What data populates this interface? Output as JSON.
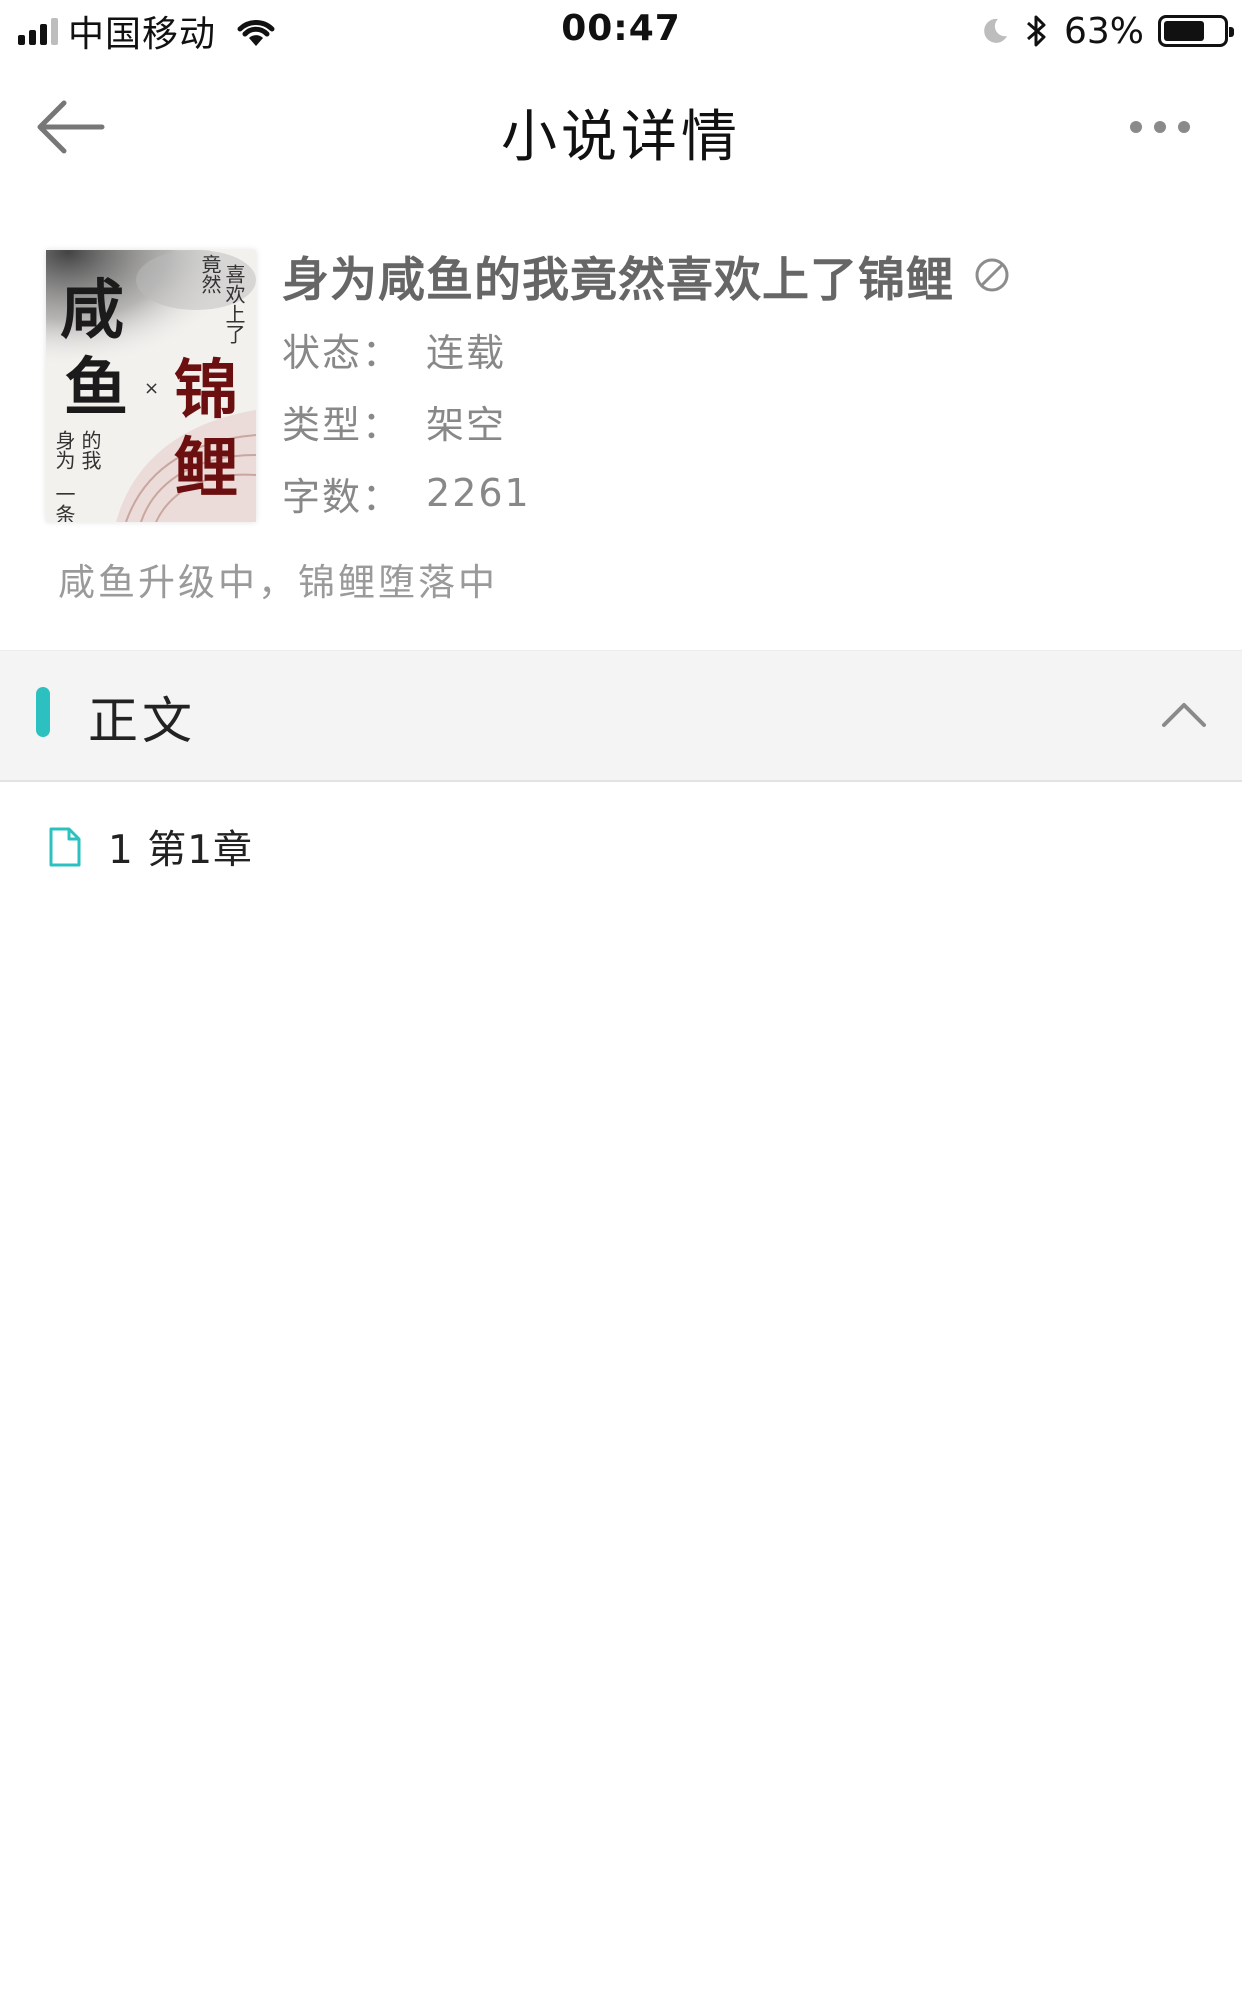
{
  "status_bar": {
    "carrier": "中国移动",
    "time": "00:47",
    "battery_percent": "63%"
  },
  "nav": {
    "title": "小说详情"
  },
  "book": {
    "title": "身为咸鱼的我竟然喜欢上了锦鲤",
    "status_label": "状态：",
    "status_value": "连载",
    "type_label": "类型：",
    "type_value": "架空",
    "word_count_label": "字数：",
    "word_count_value": "2261",
    "summary": "咸鱼升级中，锦鲤堕落中",
    "cover": {
      "big_left_1": "咸",
      "big_left_2": "鱼",
      "big_right_1": "锦",
      "big_right_2": "鲤",
      "small_top_a": "喜欢上了",
      "small_top_b": "竟然",
      "small_bottom_a": "的我",
      "small_bottom_b": "身为",
      "small_bottom_c": "一条",
      "cross": "×"
    }
  },
  "section": {
    "title": "正文",
    "accent_color": "#2cc1c0"
  },
  "chapters": [
    {
      "label": "1 第1章"
    }
  ]
}
